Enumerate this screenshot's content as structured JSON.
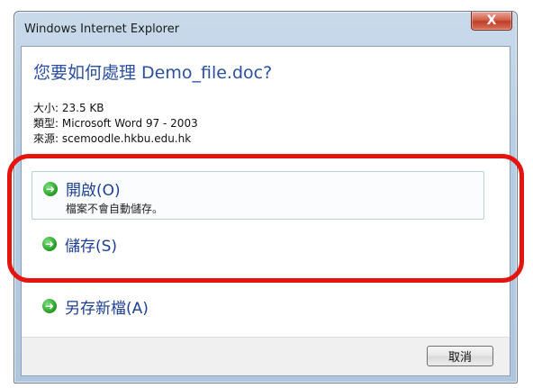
{
  "window": {
    "title": "Windows Internet Explorer",
    "close_label": "X"
  },
  "dialog": {
    "question": "您要如何處理 Demo_file.doc?",
    "info": {
      "size": "大小: 23.5 KB",
      "type": "類型: Microsoft Word 97 - 2003",
      "source": "來源: scemoodle.hkbu.edu.hk"
    }
  },
  "options": {
    "open": {
      "label": "開啟(O)",
      "sub": "檔案不會自動儲存。"
    },
    "save": {
      "label": "儲存(S)"
    },
    "save_as": {
      "label": "另存新檔(A)"
    }
  },
  "footer": {
    "cancel_label": "取消"
  },
  "icons": {
    "arrow": "green-arrow-icon"
  },
  "colors": {
    "annotation_outline": "#e4140f",
    "link_text": "#1c3f94"
  }
}
